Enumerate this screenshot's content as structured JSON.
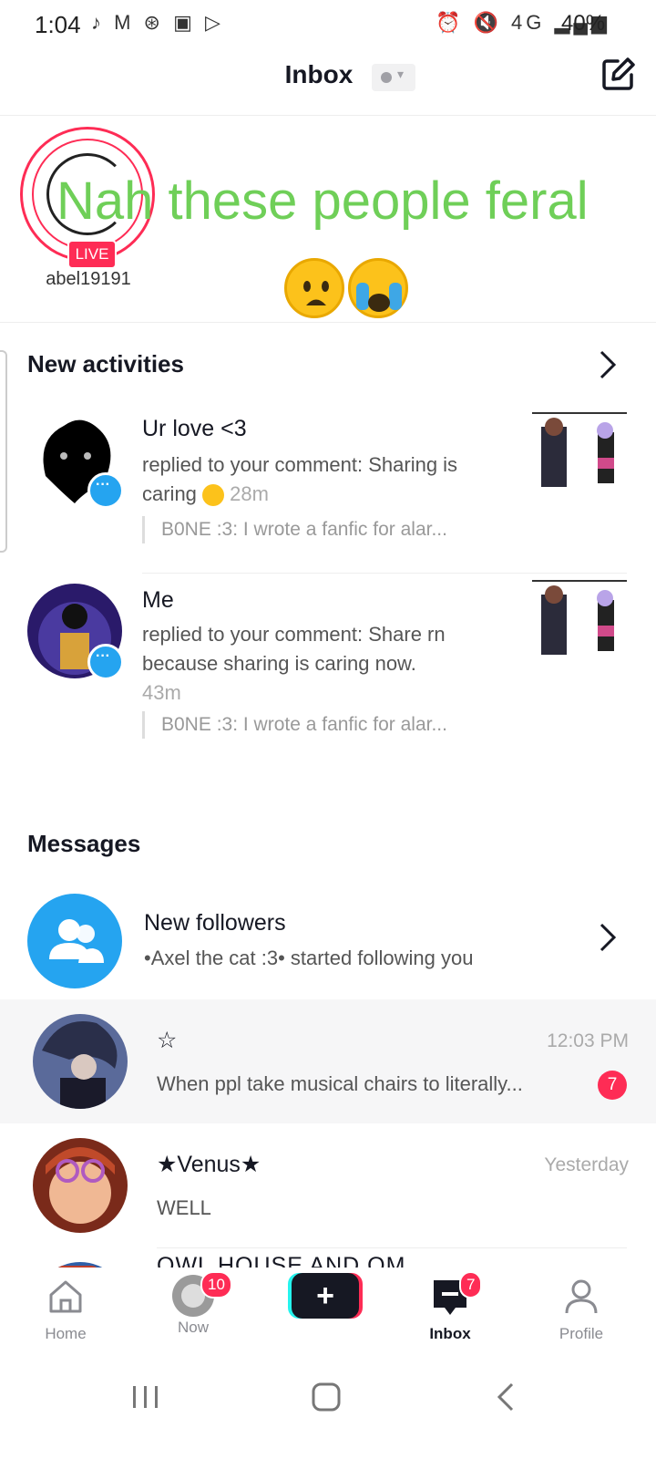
{
  "status_bar": {
    "time": "1:04",
    "left_icons": "♪ M ⊛ ▣ ▷",
    "right_icons": "⏰ 🔇 4G ▂▄▆",
    "battery": "40%"
  },
  "header": {
    "title": "Inbox"
  },
  "live": {
    "badge": "LIVE",
    "username": "abel19191",
    "overlay_caption": "Nah these people feral"
  },
  "new_activities": {
    "title": "New activities",
    "items": [
      {
        "name": "Ur love <3",
        "text": "replied to your comment: Sharing is caring",
        "time": "28m",
        "quote": "B0NE :3: I wrote a fanfic for alar..."
      },
      {
        "name": "Me",
        "text": "replied to your comment: Share rn because sharing is caring now.",
        "time": "43m",
        "quote": "B0NE :3: I wrote a fanfic for alar..."
      }
    ]
  },
  "messages": {
    "title": "Messages",
    "new_followers": {
      "title": "New followers",
      "subtitle": "•Axel the cat :3• started following you"
    },
    "threads": [
      {
        "name": "☆",
        "time": "12:03 PM",
        "preview": "When ppl take musical chairs to literally...",
        "unread": "7"
      },
      {
        "name": "★Venus★",
        "time": "Yesterday",
        "preview": "WELL"
      },
      {
        "name": "OWL HOUSE AND OM",
        "time": "",
        "preview": ""
      }
    ]
  },
  "bottom_nav": {
    "home": "Home",
    "now": "Now",
    "now_badge": "10",
    "create": "+",
    "inbox": "Inbox",
    "inbox_badge": "7",
    "profile": "Profile"
  },
  "colors": {
    "accent": "#fe2c55",
    "blue": "#25a4f0",
    "caption_green": "#6fcf58"
  }
}
